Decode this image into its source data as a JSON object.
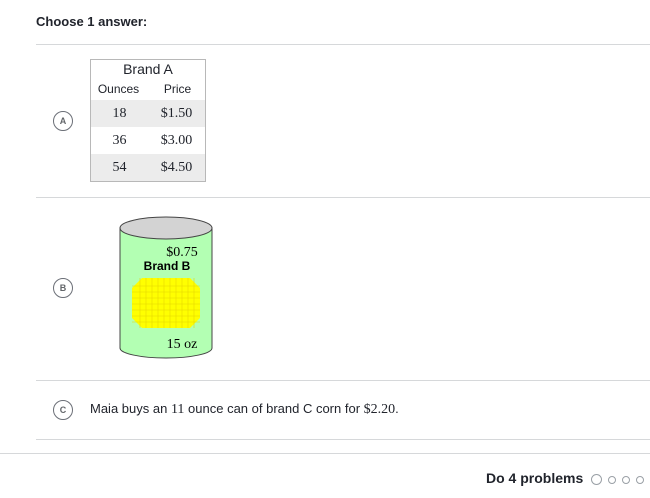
{
  "prompt": "Choose 1 answer:",
  "choices": [
    {
      "letter": "A",
      "table": {
        "caption": "Brand A",
        "headers": [
          "Ounces",
          "Price"
        ],
        "rows": [
          [
            "18",
            "$1.50"
          ],
          [
            "36",
            "$3.00"
          ],
          [
            "54",
            "$4.50"
          ]
        ]
      }
    },
    {
      "letter": "B",
      "can": {
        "price": "$0.75",
        "brand": "Brand B",
        "size": "15 oz",
        "colors": {
          "can_body": "#b3ffb3",
          "lid": "#d3d3d3",
          "corn": "#ffff00"
        }
      }
    },
    {
      "letter": "C",
      "text_before": "Maia buys an ",
      "ounces": "11",
      "text_middle": " ounce can of brand C corn for ",
      "price": "$2.20",
      "text_after": "."
    }
  ],
  "footer": {
    "label": "Do 4 problems",
    "progress_total": 4,
    "progress_current": 1
  }
}
